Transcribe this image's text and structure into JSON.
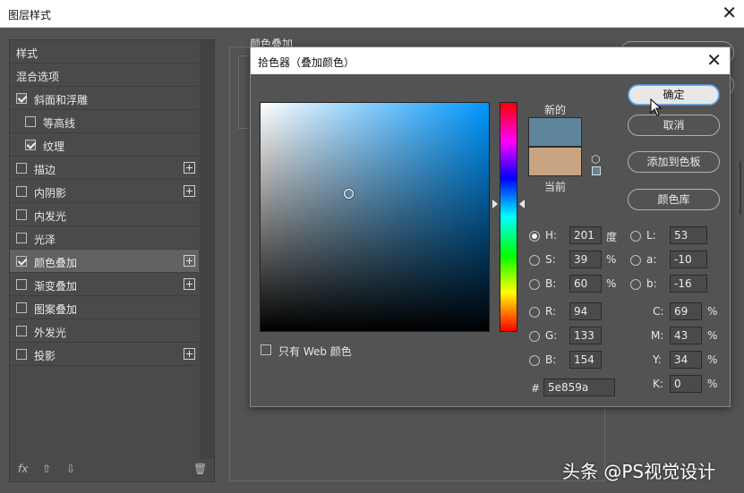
{
  "window": {
    "title": "图层样式",
    "close": "✕"
  },
  "styles": {
    "items": [
      {
        "label": "样式",
        "checkbox": false,
        "checked": false,
        "plus": false,
        "indent": false
      },
      {
        "label": "混合选项",
        "checkbox": false,
        "checked": false,
        "plus": false,
        "indent": false
      },
      {
        "label": "斜面和浮雕",
        "checkbox": true,
        "checked": true,
        "plus": false,
        "indent": false
      },
      {
        "label": "等高线",
        "checkbox": true,
        "checked": false,
        "plus": false,
        "indent": true
      },
      {
        "label": "纹理",
        "checkbox": true,
        "checked": true,
        "plus": false,
        "indent": true
      },
      {
        "label": "描边",
        "checkbox": true,
        "checked": false,
        "plus": true,
        "indent": false
      },
      {
        "label": "内阴影",
        "checkbox": true,
        "checked": false,
        "plus": true,
        "indent": false
      },
      {
        "label": "内发光",
        "checkbox": true,
        "checked": false,
        "plus": false,
        "indent": false
      },
      {
        "label": "光泽",
        "checkbox": true,
        "checked": false,
        "plus": false,
        "indent": false
      },
      {
        "label": "颜色叠加",
        "checkbox": true,
        "checked": true,
        "plus": true,
        "indent": false,
        "active": true
      },
      {
        "label": "渐变叠加",
        "checkbox": true,
        "checked": false,
        "plus": true,
        "indent": false
      },
      {
        "label": "图案叠加",
        "checkbox": true,
        "checked": false,
        "plus": false,
        "indent": false
      },
      {
        "label": "外发光",
        "checkbox": true,
        "checked": false,
        "plus": false,
        "indent": false
      },
      {
        "label": "投影",
        "checkbox": true,
        "checked": false,
        "plus": true,
        "indent": false
      }
    ],
    "footer": {
      "fx": "fx",
      "up": "⇧",
      "down": "⇩",
      "trash": "🗑"
    }
  },
  "background_group": {
    "title": "颜色叠加"
  },
  "picker": {
    "title": "拾色器（叠加颜色）",
    "close": "✕",
    "new_label": "新的",
    "current_label": "当前",
    "new_color": "#5e859a",
    "current_color": "#c9a483",
    "hue_color": "#0097ff",
    "web_only_label": "只有 Web 颜色",
    "buttons": {
      "ok": "确定",
      "cancel": "取消",
      "add_swatch": "添加到色板",
      "libraries": "颜色库"
    },
    "hsb": {
      "h": {
        "label": "H:",
        "value": "201",
        "unit": "度",
        "selected": true
      },
      "s": {
        "label": "S:",
        "value": "39",
        "unit": "%"
      },
      "b": {
        "label": "B:",
        "value": "60",
        "unit": "%"
      }
    },
    "rgb": {
      "r": {
        "label": "R:",
        "value": "94"
      },
      "g": {
        "label": "G:",
        "value": "133"
      },
      "b": {
        "label": "B:",
        "value": "154"
      }
    },
    "lab": {
      "l": {
        "label": "L:",
        "value": "53"
      },
      "a": {
        "label": "a:",
        "value": "-10"
      },
      "b": {
        "label": "b:",
        "value": "-16"
      }
    },
    "cmyk": {
      "c": {
        "label": "C:",
        "value": "69",
        "unit": "%"
      },
      "m": {
        "label": "M:",
        "value": "43",
        "unit": "%"
      },
      "y": {
        "label": "Y:",
        "value": "34",
        "unit": "%"
      },
      "k": {
        "label": "K:",
        "value": "0",
        "unit": "%"
      }
    },
    "hex": {
      "label": "#",
      "value": "5e859a"
    }
  },
  "watermark": "头条 @PS视觉设计"
}
